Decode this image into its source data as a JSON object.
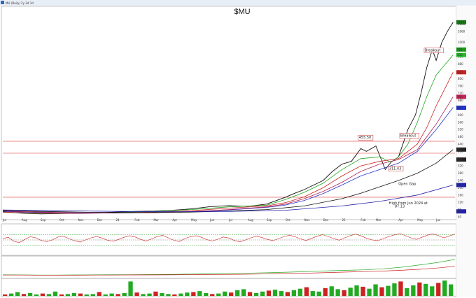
{
  "window": {
    "title": "MU (Daily) 2y 2d 1d"
  },
  "chart_data": {
    "type": "line",
    "title": "$MU",
    "price_axis_ticks": [
      "1100",
      "1060",
      "1000",
      "960",
      "920",
      "880",
      "840",
      "800",
      "760",
      "720",
      "680",
      "640",
      "600",
      "560",
      "520",
      "480",
      "440",
      "400",
      "360",
      "320",
      "280",
      "240",
      "200",
      "160",
      "120",
      "80",
      "40"
    ],
    "price_right_labels": [
      {
        "value": 1110,
        "text": "1110",
        "color": "#1a7a1a"
      },
      {
        "value": 960,
        "text": "963",
        "color": "#1a9a1a"
      },
      {
        "value": 930,
        "text": "930",
        "color": "#22bb22"
      },
      {
        "value": 835,
        "text": "835",
        "color": "#cc2222"
      },
      {
        "value": 700,
        "text": "700",
        "color": "#cc2255"
      },
      {
        "value": 640,
        "text": "642",
        "color": "#2233cc"
      },
      {
        "value": 410,
        "text": "410",
        "color": "#222222"
      },
      {
        "value": 355,
        "text": "355",
        "color": "#222222"
      },
      {
        "value": 215,
        "text": "215",
        "color": "#2222aa"
      },
      {
        "value": 70,
        "text": "70",
        "color": "#2222aa"
      }
    ],
    "x_axis_labels": [
      "Jul",
      "Aug",
      "Sep",
      "Oct",
      "Nov",
      "Dec",
      "24",
      "Feb",
      "Mar",
      "Apr",
      "May",
      "Jun",
      "Jul",
      "Aug",
      "Sep",
      "Oct",
      "Nov",
      "Dec",
      "25",
      "Feb",
      "Mar",
      "Apr",
      "May",
      "Jun"
    ],
    "x_axis_label_months": [
      0,
      1,
      2,
      3,
      4,
      5,
      6,
      7,
      8,
      9,
      10,
      11,
      12,
      13,
      14,
      15,
      16,
      17,
      18,
      19,
      19.8,
      21,
      22,
      23
    ],
    "series": [
      {
        "name": "",
        "color": "#111111",
        "type": "price",
        "x": [
          0,
          1,
          2,
          3,
          4,
          5,
          6,
          7,
          8,
          9,
          10,
          11,
          12,
          13,
          14,
          15,
          15.5,
          16,
          17,
          17.5,
          18,
          18.5,
          19,
          19.3,
          19.8,
          20.3,
          20.6,
          21,
          21.5,
          21.9,
          22.2,
          22.5,
          22.8,
          23,
          23.3,
          23.6,
          23.9
        ],
        "y": [
          68,
          60,
          56,
          58,
          60,
          62,
          66,
          70,
          72,
          76,
          84,
          96,
          102,
          98,
          110,
          148,
          170,
          190,
          240,
          290,
          330,
          345,
          415,
          400,
          430,
          300,
          340,
          370,
          520,
          600,
          720,
          860,
          960,
          900,
          1000,
          1060,
          1110
        ]
      },
      {
        "name": "",
        "color": "#22aa22",
        "type": "ma",
        "x": [
          0,
          2,
          4,
          6,
          8,
          10,
          12,
          14,
          15,
          16,
          17,
          18,
          19,
          20,
          20.6,
          21,
          21.5,
          22,
          22.5,
          23,
          23.9
        ],
        "y": [
          65,
          58,
          60,
          64,
          70,
          80,
          95,
          104,
          135,
          175,
          225,
          300,
          360,
          370,
          340,
          370,
          440,
          560,
          700,
          820,
          930
        ]
      },
      {
        "name": "",
        "color": "#cc2222",
        "type": "ma",
        "x": [
          0,
          2,
          4,
          6,
          8,
          10,
          12,
          14,
          15,
          16,
          17,
          18,
          19,
          20,
          21,
          22,
          22.5,
          23,
          23.9
        ],
        "y": [
          66,
          60,
          59,
          62,
          66,
          74,
          88,
          100,
          118,
          150,
          200,
          265,
          320,
          345,
          360,
          440,
          530,
          650,
          835
        ]
      },
      {
        "name": "",
        "color": "#2233cc",
        "type": "ma",
        "x": [
          0,
          2,
          4,
          6,
          8,
          10,
          12,
          14,
          15,
          16,
          17,
          18,
          19,
          20,
          21,
          22,
          23,
          23.9
        ],
        "y": [
          70,
          64,
          60,
          61,
          63,
          68,
          78,
          92,
          105,
          130,
          168,
          215,
          265,
          300,
          335,
          400,
          520,
          642
        ]
      },
      {
        "name": "",
        "color": "#b22255",
        "type": "ma",
        "x": [
          0,
          2,
          4,
          6,
          8,
          10,
          12,
          14,
          15,
          16,
          17,
          18,
          19,
          20,
          21,
          22,
          23,
          23.9
        ],
        "y": [
          72,
          66,
          62,
          62,
          64,
          69,
          80,
          95,
          110,
          140,
          180,
          230,
          290,
          330,
          355,
          410,
          550,
          700
        ]
      },
      {
        "name": "",
        "color": "#111111",
        "type": "ma",
        "x": [
          0,
          2,
          4,
          6,
          8,
          10,
          12,
          14,
          16,
          18,
          19,
          20,
          21,
          22,
          23,
          23.9
        ],
        "y": [
          75,
          70,
          66,
          64,
          64,
          66,
          72,
          80,
          100,
          140,
          170,
          205,
          240,
          280,
          335,
          410
        ]
      },
      {
        "name": "",
        "color": "#2222aa",
        "type": "ma",
        "x": [
          0,
          3,
          6,
          9,
          12,
          15,
          18,
          20,
          22,
          23.9
        ],
        "y": [
          78,
          74,
          70,
          68,
          70,
          76,
          100,
          125,
          160,
          215
        ]
      }
    ],
    "hlines": [
      {
        "value": 148,
        "color": "#dd3333"
      },
      {
        "value": 455.5,
        "color": "#dd3333"
      },
      {
        "value": 390,
        "color": "#dd3333"
      }
    ],
    "annotations": [
      {
        "text": "Breakout",
        "x": 22.4,
        "y": 950
      },
      {
        "text": "Breakout",
        "x": 21.1,
        "y": 480
      },
      {
        "text": "455.50",
        "x": 18.9,
        "y": 470
      },
      {
        "text": "311.43",
        "x": 20.5,
        "y": 300
      },
      {
        "text": "Open Gap",
        "x": 21.0,
        "y": 215
      },
      {
        "text": "High from Jun 2024 at",
        "x": 20.5,
        "y": 110
      },
      {
        "text": "87.13",
        "x": 20.8,
        "y": 92
      }
    ],
    "xlim": [
      0,
      24
    ],
    "ylim": [
      40,
      1140
    ],
    "rsi": {
      "name": "",
      "color": "#cc2222",
      "ylim": [
        0,
        100
      ],
      "levels": [
        70,
        50,
        30
      ],
      "values": [
        55,
        60,
        45,
        40,
        52,
        62,
        58,
        48,
        44,
        50,
        61,
        64,
        55,
        47,
        42,
        50,
        58,
        63,
        57,
        49,
        45,
        52,
        60,
        66,
        61,
        52,
        46,
        54,
        63,
        67,
        58,
        49,
        44,
        55,
        62,
        66,
        60,
        51,
        46,
        53,
        61,
        57,
        48,
        43,
        50,
        58,
        64,
        59,
        52,
        47,
        55,
        63,
        68,
        62,
        54,
        48,
        56,
        64,
        70,
        63,
        55,
        49,
        58,
        66,
        72,
        65,
        56,
        50,
        47,
        55,
        63,
        69,
        74,
        66,
        58,
        52,
        60,
        68,
        73,
        66,
        58,
        65,
        72
      ]
    },
    "relative": {
      "name": "",
      "color": "#cc2222",
      "values": [
        10,
        10,
        9,
        9,
        9,
        10,
        10,
        11,
        11,
        12,
        13,
        14,
        15,
        16,
        18,
        20,
        23,
        26,
        30,
        34,
        38,
        42,
        48,
        56,
        66,
        80
      ]
    },
    "relative_green": {
      "name": "",
      "color": "#22aa22",
      "values": [
        12,
        11,
        10,
        10,
        11,
        12,
        13,
        13,
        14,
        15,
        17,
        19,
        22,
        24,
        27,
        30,
        34,
        38,
        44,
        48,
        52,
        60,
        72,
        90,
        110,
        135
      ]
    },
    "volume": {
      "values": [
        3,
        5,
        8,
        4,
        6,
        3,
        5,
        4,
        9,
        3,
        4,
        6,
        5,
        3,
        4,
        8,
        3,
        5,
        4,
        6,
        30,
        7,
        4,
        5,
        9,
        6,
        4,
        3,
        5,
        7,
        8,
        10,
        6,
        4,
        5,
        9,
        7,
        12,
        14,
        8,
        6,
        9,
        11,
        13,
        10,
        8,
        12,
        15,
        18,
        10,
        9,
        16,
        20,
        14,
        12,
        17,
        22,
        19,
        15,
        24,
        18,
        21,
        26,
        30,
        16,
        22,
        28,
        25,
        20,
        27,
        32,
        24
      ]
    }
  }
}
